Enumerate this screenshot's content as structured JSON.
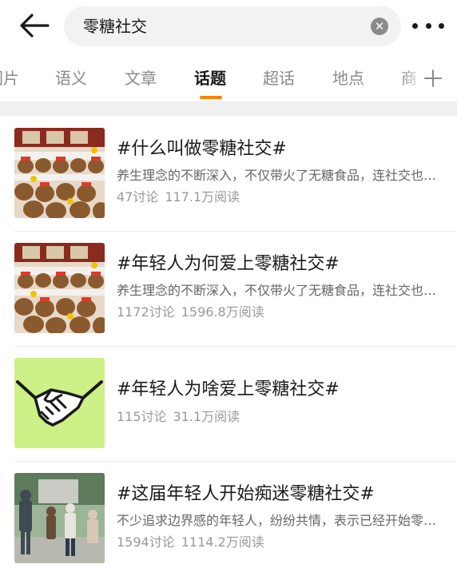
{
  "search": {
    "query": "零糖社交"
  },
  "tabs": [
    {
      "label": "图片"
    },
    {
      "label": "语义"
    },
    {
      "label": "文章"
    },
    {
      "label": "话题"
    },
    {
      "label": "超话"
    },
    {
      "label": "地点"
    },
    {
      "label": "商"
    }
  ],
  "active_tab": "话题",
  "colors": {
    "accent": "#ff8200"
  },
  "topics": [
    {
      "title": "#什么叫做零糖社交#",
      "excerpt": "养生理念的不断深入，不仅带火了无糖食品，连社交也开始讲究零糖",
      "discussions": "47讨论",
      "reads": "117.1万阅读",
      "thumb": "plush-toys-photo"
    },
    {
      "title": "#年轻人为何爱上零糖社交#",
      "excerpt": "养生理念的不断深入，不仅带火了无糖食品，连社交也开始讲究零糖",
      "discussions": "1172讨论",
      "reads": "1596.8万阅读",
      "thumb": "plush-toys-photo"
    },
    {
      "title": "#年轻人为啥爱上零糖社交#",
      "excerpt": "",
      "discussions": "115讨论",
      "reads": "31.1万阅读",
      "thumb": "handshake-icon"
    },
    {
      "title": "#这届年轻人开始痴迷零糖社交#",
      "excerpt": "不少追求边界感的年轻人，纷纷共情，表示已经开始零糖社交",
      "discussions": "1594讨论",
      "reads": "1114.2万阅读",
      "thumb": "people-photo"
    }
  ]
}
